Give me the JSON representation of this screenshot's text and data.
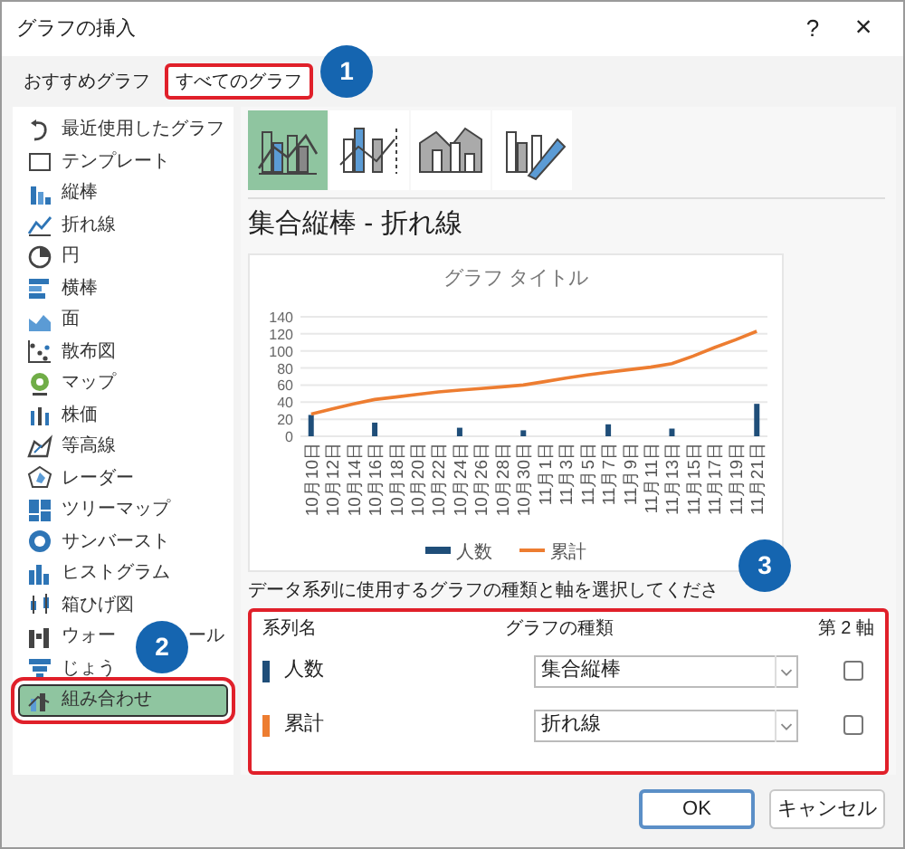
{
  "window": {
    "title": "グラフの挿入",
    "help": "?",
    "close": "×"
  },
  "tabs": [
    {
      "label": "おすすめグラフ",
      "selected": false,
      "highlighted": false
    },
    {
      "label": "すべてのグラフ",
      "selected": true,
      "highlighted": true
    }
  ],
  "sidebar": {
    "items": [
      {
        "label": "最近使用したグラフ",
        "selected": false,
        "highlighted": false
      },
      {
        "label": "テンプレート",
        "selected": false,
        "highlighted": false
      },
      {
        "label": "縦棒",
        "selected": false,
        "highlighted": false
      },
      {
        "label": "折れ線",
        "selected": false,
        "highlighted": false
      },
      {
        "label": "円",
        "selected": false,
        "highlighted": false
      },
      {
        "label": "横棒",
        "selected": false,
        "highlighted": false
      },
      {
        "label": "面",
        "selected": false,
        "highlighted": false
      },
      {
        "label": "散布図",
        "selected": false,
        "highlighted": false
      },
      {
        "label": "マップ",
        "selected": false,
        "highlighted": false
      },
      {
        "label": "株価",
        "selected": false,
        "highlighted": false
      },
      {
        "label": "等高線",
        "selected": false,
        "highlighted": false
      },
      {
        "label": "レーダー",
        "selected": false,
        "highlighted": false
      },
      {
        "label": "ツリーマップ",
        "selected": false,
        "highlighted": false
      },
      {
        "label": "サンバースト",
        "selected": false,
        "highlighted": false
      },
      {
        "label": "ヒストグラム",
        "selected": false,
        "highlighted": false
      },
      {
        "label": "箱ひげ図",
        "selected": false,
        "highlighted": false
      },
      {
        "label": "ウォー",
        "label_tail": "ール",
        "selected": false,
        "highlighted": false
      },
      {
        "label": "じょう",
        "selected": false,
        "highlighted": false
      },
      {
        "label": "組み合わせ",
        "selected": true,
        "highlighted": true
      }
    ]
  },
  "subtypes": [
    {
      "selected": true
    },
    {
      "selected": false
    },
    {
      "selected": false
    },
    {
      "selected": false
    }
  ],
  "heading": "集合縦棒 - 折れ線",
  "chart": {
    "chart_data": {
      "type": "bar",
      "title": "グラフ タイトル",
      "categories": [
        "10月10日",
        "10月12日",
        "10月14日",
        "10月16日",
        "10月18日",
        "10月20日",
        "10月22日",
        "10月24日",
        "10月26日",
        "10月28日",
        "10月30日",
        "11月1日",
        "11月3日",
        "11月5日",
        "11月7日",
        "11月9日",
        "11月11日",
        "11月13日",
        "11月15日",
        "11月17日",
        "11月19日",
        "11月21日"
      ],
      "series": [
        {
          "name": "人数",
          "type": "bar",
          "color": "#1f4e79",
          "values": [
            25,
            null,
            null,
            16,
            null,
            null,
            null,
            10,
            null,
            null,
            7,
            null,
            null,
            null,
            14,
            null,
            null,
            9,
            null,
            null,
            null,
            38
          ]
        },
        {
          "name": "累計",
          "type": "line",
          "color": "#ed7d31",
          "values": [
            26,
            32,
            38,
            43,
            46,
            49,
            52,
            54,
            56,
            58,
            60,
            64,
            68,
            72,
            75,
            78,
            81,
            85,
            94,
            104,
            113,
            123
          ]
        }
      ],
      "stacked": false,
      "grid": true,
      "legend": "bottom",
      "ylim": [
        0,
        140
      ],
      "yticks": [
        0,
        20,
        40,
        60,
        80,
        100,
        120,
        140
      ]
    }
  },
  "instruction": "データ系列に使用するグラフの種類と軸を選択してくださ",
  "table": {
    "highlighted": true,
    "columns": [
      "系列名",
      "グラフの種類",
      "第 2 軸"
    ],
    "rows": [
      {
        "name": "人数",
        "color": "#1f4e79",
        "chart_type": "集合縦棒",
        "secondary_axis": false
      },
      {
        "name": "累計",
        "color": "#ed7d31",
        "chart_type": "折れ線",
        "secondary_axis": false
      }
    ]
  },
  "buttons": [
    {
      "label": "OK",
      "default": true
    },
    {
      "label": "キャンセル",
      "default": false
    }
  ],
  "callouts": [
    {
      "number": "1"
    },
    {
      "number": "2"
    },
    {
      "number": "3"
    }
  ]
}
